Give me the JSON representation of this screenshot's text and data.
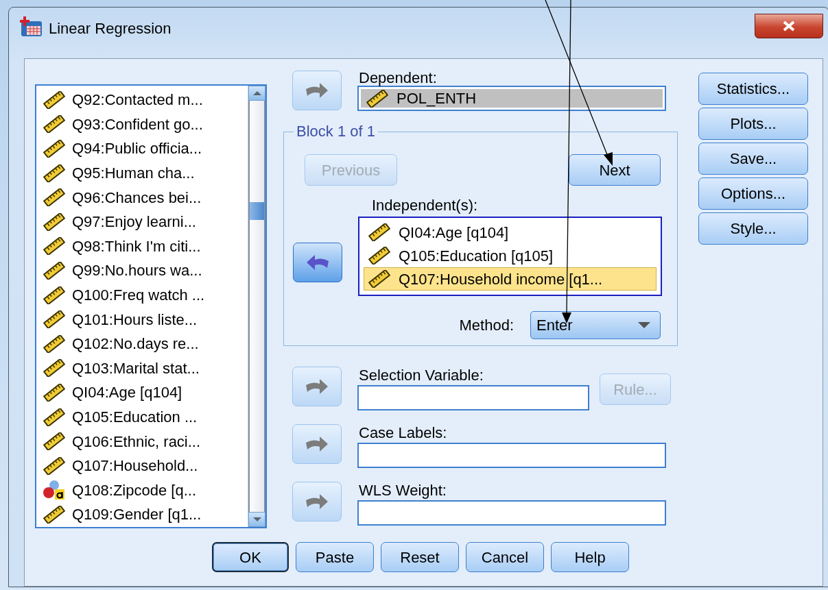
{
  "window": {
    "title": "Linear Regression"
  },
  "variables": [
    {
      "label": "Q92:Contacted m...",
      "kind": "scale"
    },
    {
      "label": "Q93:Confident go...",
      "kind": "scale"
    },
    {
      "label": "Q94:Public officia...",
      "kind": "scale"
    },
    {
      "label": "Q95:Human cha...",
      "kind": "scale"
    },
    {
      "label": "Q96:Chances bei...",
      "kind": "scale"
    },
    {
      "label": "Q97:Enjoy learni...",
      "kind": "scale"
    },
    {
      "label": "Q98:Think I'm citi...",
      "kind": "scale"
    },
    {
      "label": "Q99:No.hours wa...",
      "kind": "scale"
    },
    {
      "label": "Q100:Freq watch ...",
      "kind": "scale"
    },
    {
      "label": "Q101:Hours liste...",
      "kind": "scale"
    },
    {
      "label": "Q102:No.days re...",
      "kind": "scale"
    },
    {
      "label": "Q103:Marital stat...",
      "kind": "scale"
    },
    {
      "label": "QI04:Age [q104]",
      "kind": "scale"
    },
    {
      "label": "Q105:Education  ...",
      "kind": "scale"
    },
    {
      "label": "Q106:Ethnic, raci...",
      "kind": "scale"
    },
    {
      "label": "Q107:Household...",
      "kind": "scale"
    },
    {
      "label": "Q108:Zipcode [q...",
      "kind": "nominal"
    },
    {
      "label": "Q109:Gender [q1...",
      "kind": "scale"
    }
  ],
  "dependent": {
    "label": "Dependent:",
    "value": "POL_ENTH",
    "kind": "scale",
    "transfer": {
      "kind": "add",
      "enabled": false
    }
  },
  "block": {
    "title": "Block 1 of 1",
    "previous": {
      "label": "Previous",
      "disabled": true
    },
    "next": {
      "label": "Next",
      "disabled": false
    },
    "independents_label": "Independent(s):",
    "transfer": {
      "kind": "remove",
      "enabled": true
    },
    "independents": [
      {
        "label": "QI04:Age [q104]",
        "kind": "scale",
        "selected": false
      },
      {
        "label": "Q105:Education  [q105]",
        "kind": "scale",
        "selected": false
      },
      {
        "label": "Q107:Household income [q1...",
        "kind": "scale",
        "selected": true
      }
    ],
    "method_label": "Method:",
    "method": "Enter"
  },
  "fields": [
    {
      "label": "Selection Variable:",
      "transfer": {
        "kind": "add",
        "enabled": false
      },
      "rule_button": {
        "label": "Rule...",
        "disabled": true
      }
    },
    {
      "label": "Case Labels:",
      "transfer": {
        "kind": "add",
        "enabled": false
      }
    },
    {
      "label": "WLS Weight:",
      "transfer": {
        "kind": "add",
        "enabled": false
      }
    }
  ],
  "side_buttons": [
    "Statistics...",
    "Plots...",
    "Save...",
    "Options...",
    "Style..."
  ],
  "bottom_buttons": [
    {
      "label": "OK",
      "default": true
    },
    {
      "label": "Paste",
      "default": false
    },
    {
      "label": "Reset",
      "default": false
    },
    {
      "label": "Cancel",
      "default": false
    },
    {
      "label": "Help",
      "default": false
    }
  ]
}
